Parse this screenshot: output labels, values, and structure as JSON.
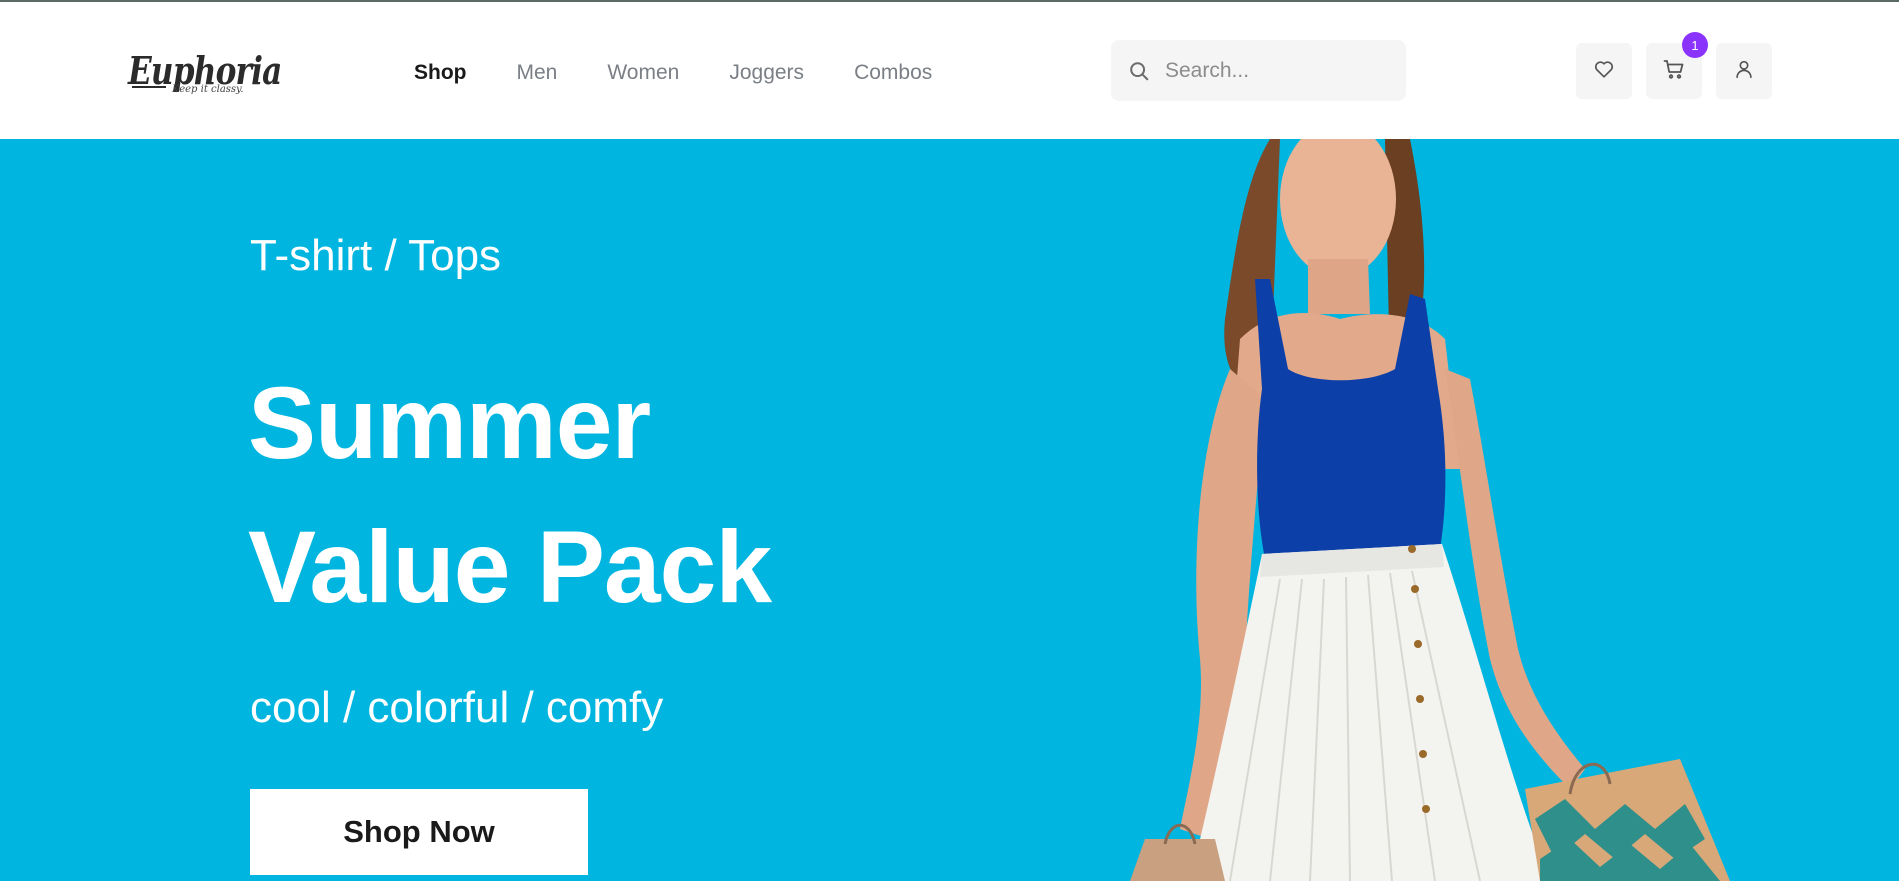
{
  "header": {
    "logo": {
      "name": "Euphoria",
      "tagline": "Keep it classy."
    },
    "nav": [
      {
        "label": "Shop",
        "active": true
      },
      {
        "label": "Men",
        "active": false
      },
      {
        "label": "Women",
        "active": false
      },
      {
        "label": "Joggers",
        "active": false
      },
      {
        "label": "Combos",
        "active": false
      }
    ],
    "search": {
      "placeholder": "Search...",
      "value": "",
      "icon": "search-icon"
    },
    "icons": [
      {
        "name": "wishlist",
        "icon": "heart-icon"
      },
      {
        "name": "cart",
        "icon": "cart-icon",
        "badge": "1"
      },
      {
        "name": "account",
        "icon": "user-icon"
      }
    ]
  },
  "hero": {
    "subtitle": "T-shirt / Tops",
    "title_line1": "Summer",
    "title_line2": "Value Pack",
    "tagline": "cool / colorful / comfy",
    "cta_label": "Shop Now"
  },
  "colors": {
    "hero_background": "#00b6e0",
    "badge": "#8a33fd",
    "nav_active": "#1a1a1a",
    "nav_inactive": "#7a7f86",
    "icon_button_bg": "#f5f5f5"
  }
}
